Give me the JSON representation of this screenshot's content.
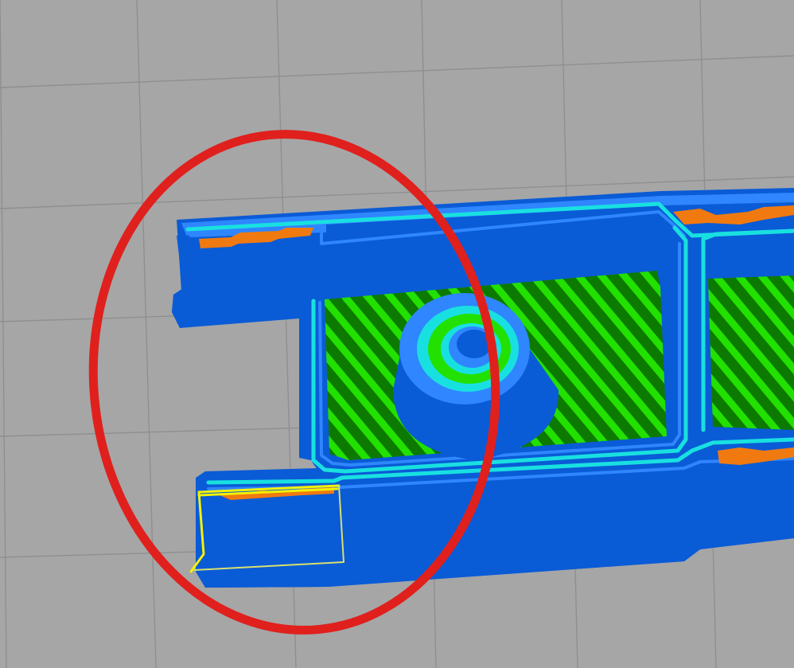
{
  "viewport": {
    "name": "slicer-3d-preview",
    "description_visible_text": ""
  },
  "colors": {
    "bed": "#a6a6a6",
    "grid_line": "#8f8f8f",
    "perimeter_outer": "#0a5bd6",
    "perimeter_inner": "#2f86ff",
    "perimeter_cyan": "#19e0e0",
    "infill_solid": "#f07a10",
    "infill_sparse_green": "#22e000",
    "infill_sparse_dark": "#0c7a00",
    "annotation_circle": "#e0201d",
    "travel_highlight": "#f2f200"
  },
  "layers": {
    "grid": "grid",
    "part_body": "part-body",
    "infill": "infill",
    "boss": "boss",
    "annotation": "annotation",
    "tool_path": "tool-path"
  }
}
